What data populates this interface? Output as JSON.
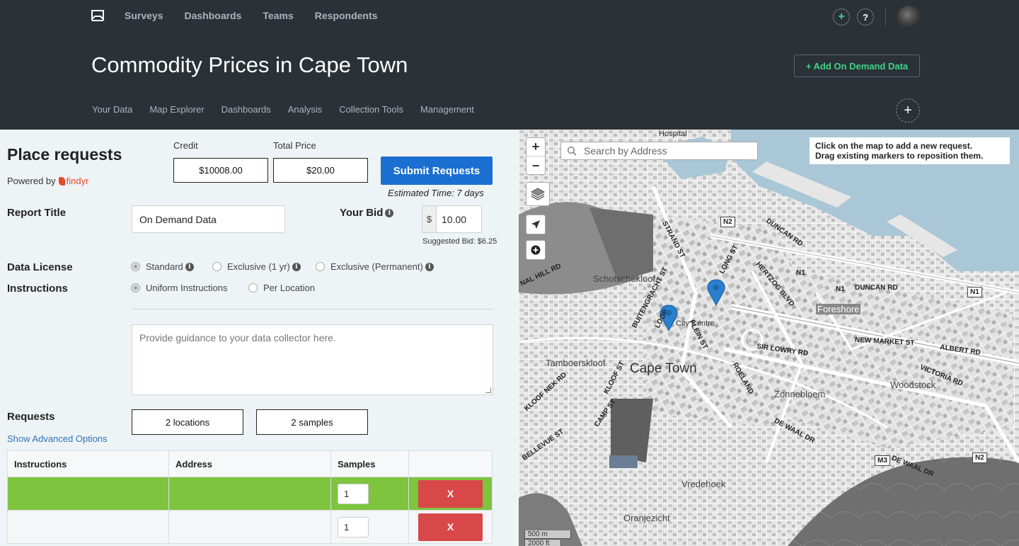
{
  "nav": {
    "items": [
      "Surveys",
      "Dashboards",
      "Teams",
      "Respondents"
    ],
    "plus_label": "+",
    "help_label": "?"
  },
  "page": {
    "title": "Commodity Prices in Cape Town",
    "on_demand_label": "+ Add On Demand Data"
  },
  "subnav": {
    "items": [
      "Your Data",
      "Map Explorer",
      "Dashboards",
      "Analysis",
      "Collection Tools",
      "Management"
    ],
    "add_label": "+"
  },
  "form": {
    "heading": "Place requests",
    "powered_by": "Powered by",
    "brand": "findyr",
    "credit_label": "Credit",
    "credit_value": "$10008.00",
    "total_price_label": "Total Price",
    "total_price_value": "$20.00",
    "submit_label": "Submit Requests",
    "estimated_time": "Estimated Time: 7 days",
    "report_title_label": "Report Title",
    "report_title_value": "On Demand Data",
    "your_bid_label": "Your Bid",
    "currency": "$",
    "bid_value": "10.00",
    "suggested_bid": "Suggested Bid: $6.25",
    "data_license_label": "Data License",
    "license_options": [
      {
        "label": "Standard",
        "selected": true
      },
      {
        "label": "Exclusive (1 yr)",
        "selected": false
      },
      {
        "label": "Exclusive (Permanent)",
        "selected": false
      }
    ],
    "instructions_label": "Instructions",
    "instruction_options": [
      {
        "label": "Uniform Instructions",
        "selected": true
      },
      {
        "label": "Per Location",
        "selected": false
      }
    ],
    "instructions_placeholder": "Provide guidance to your data collector here.",
    "requests_label": "Requests",
    "locations_count": "2 locations",
    "samples_count": "2 samples",
    "advanced_link": "Show Advanced Options",
    "table_headers": [
      "Instructions",
      "Address",
      "Samples",
      ""
    ],
    "rows": [
      {
        "instructions": "",
        "address": "",
        "samples": "1",
        "delete_label": "X",
        "selected": true
      },
      {
        "instructions": "",
        "address": "",
        "samples": "1",
        "delete_label": "X",
        "selected": false
      }
    ]
  },
  "map": {
    "zoom_in": "+",
    "zoom_out": "−",
    "search_placeholder": "Search by Address",
    "hint_line1": "Click on the map to add a new request.",
    "hint_line2": "Drag existing markers to reposition them.",
    "scale_m": "500 m",
    "scale_ft": "2000 ft",
    "labels": {
      "city": "Cape Town",
      "schotschekloof": "Schotschekloof",
      "tamboerskloof": "Tamboerskloof",
      "foreshore": "Foreshore",
      "zonnebloem": "Zonnebloem",
      "woodstock": "Woodstock",
      "oranjezicht": "Oranjezicht",
      "vredehoek": "Vredehoek",
      "city_centre": "City Centre",
      "strand": "STRAND ST",
      "buitengracht": "BUITENGRACHT ST",
      "long": "LONG ST",
      "loop": "LOOP",
      "plein": "PLEIN ST",
      "roeland": "ROELAND",
      "heritzog": "HERTZOG BLVD",
      "duncan": "DUNCAN RD",
      "duncan2": "DUNCAN RD",
      "sir_lowry": "SIR LOWRY RD",
      "new_market": "NEW MARKET ST",
      "albert": "ALBERT RD",
      "victoria": "VICTORIA RD",
      "de_waal": "DE WAAL DR",
      "de_waal2": "DE WAAL DR",
      "kloof_nek": "KLOOF NEK RD",
      "kloof": "KLOOF ST",
      "camp": "CAMP ST",
      "bellevue": "BELLEVUE ST",
      "signal_hill": "NAL HILL RD",
      "hospital": "Hospital",
      "n1": "N1",
      "n1b": "N1",
      "n1c": "N1",
      "n2": "N2",
      "n2b": "N2",
      "m3": "M3"
    }
  }
}
